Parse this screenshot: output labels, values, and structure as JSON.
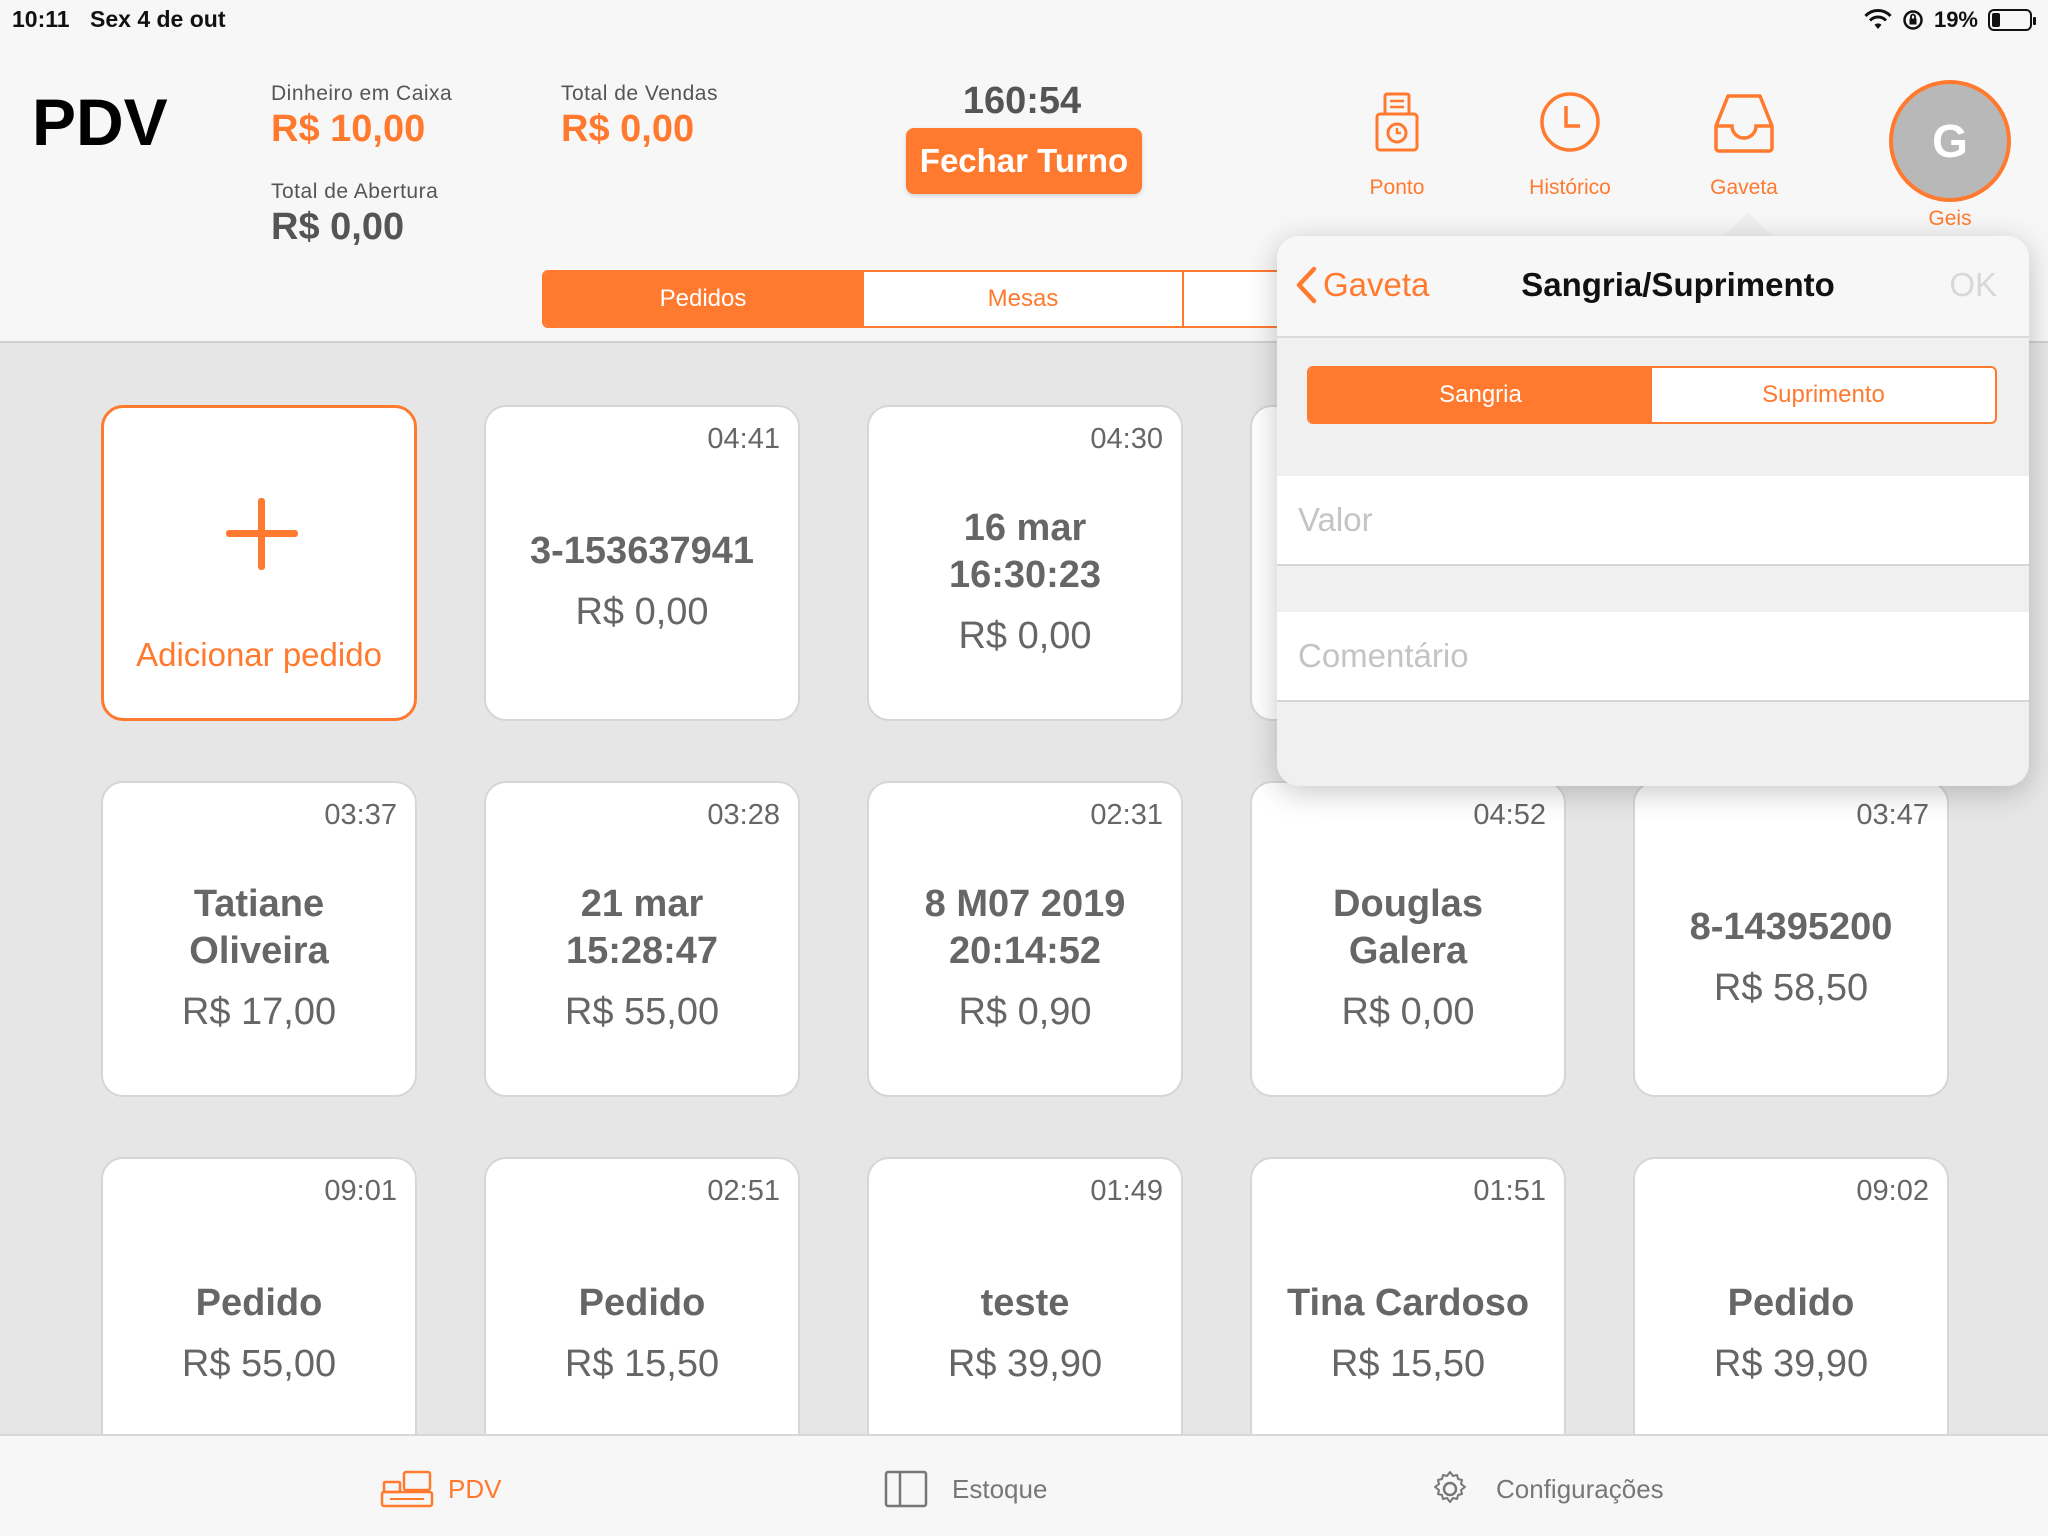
{
  "status_bar": {
    "time": "10:11",
    "date": "Sex 4 de out",
    "battery": "19%"
  },
  "header": {
    "title": "PDV",
    "cash": {
      "label": "Dinheiro em Caixa",
      "value": "R$ 10,00"
    },
    "sales": {
      "label": "Total de Vendas",
      "value": "R$ 0,00"
    },
    "opening": {
      "label": "Total de Abertura",
      "value": "R$ 0,00"
    },
    "timer": "160:54",
    "close_shift": "Fechar Turno",
    "nav": {
      "ponto": "Ponto",
      "historico": "Histórico",
      "gaveta": "Gaveta"
    },
    "user": {
      "initial": "G",
      "name": "Geis"
    }
  },
  "segments": {
    "pedidos": "Pedidos",
    "mesas": "Mesas"
  },
  "add_order": {
    "label": "Adicionar pedido"
  },
  "orders": [
    {
      "time": "04:41",
      "name": "3-153637941",
      "price": "R$ 0,00"
    },
    {
      "time": "04:30",
      "name": "16 mar\n16:30:23",
      "price": "R$ 0,00"
    },
    {
      "time": "",
      "name": "",
      "price": ""
    },
    {
      "time": "",
      "name": "",
      "price": ""
    },
    {
      "time": "03:37",
      "name": "Tatiane\nOliveira",
      "price": "R$ 17,00"
    },
    {
      "time": "03:28",
      "name": "21 mar\n15:28:47",
      "price": "R$ 55,00"
    },
    {
      "time": "02:31",
      "name": "8 M07 2019\n20:14:52",
      "price": "R$ 0,90"
    },
    {
      "time": "04:52",
      "name": "Douglas\nGalera",
      "price": "R$ 0,00"
    },
    {
      "time": "03:47",
      "name": "8-14395200",
      "price": "R$ 58,50"
    },
    {
      "time": "09:01",
      "name": "Pedido",
      "price": "R$ 55,00"
    },
    {
      "time": "02:51",
      "name": "Pedido",
      "price": "R$ 15,50"
    },
    {
      "time": "01:49",
      "name": "teste",
      "price": "R$ 39,90"
    },
    {
      "time": "01:51",
      "name": "Tina Cardoso",
      "price": "R$ 15,50"
    },
    {
      "time": "09:02",
      "name": "Pedido",
      "price": "R$ 39,90"
    }
  ],
  "popover": {
    "back": "Gaveta",
    "title": "Sangria/Suprimento",
    "ok": "OK",
    "seg_sangria": "Sangria",
    "seg_suprimento": "Suprimento",
    "valor_placeholder": "Valor",
    "comentario_placeholder": "Comentário"
  },
  "tabbar": {
    "pdv": "PDV",
    "estoque": "Estoque",
    "config": "Configurações"
  },
  "colors": {
    "accent": "#ff7a2f",
    "text_gray": "#666666",
    "background": "#e6e6e6"
  }
}
